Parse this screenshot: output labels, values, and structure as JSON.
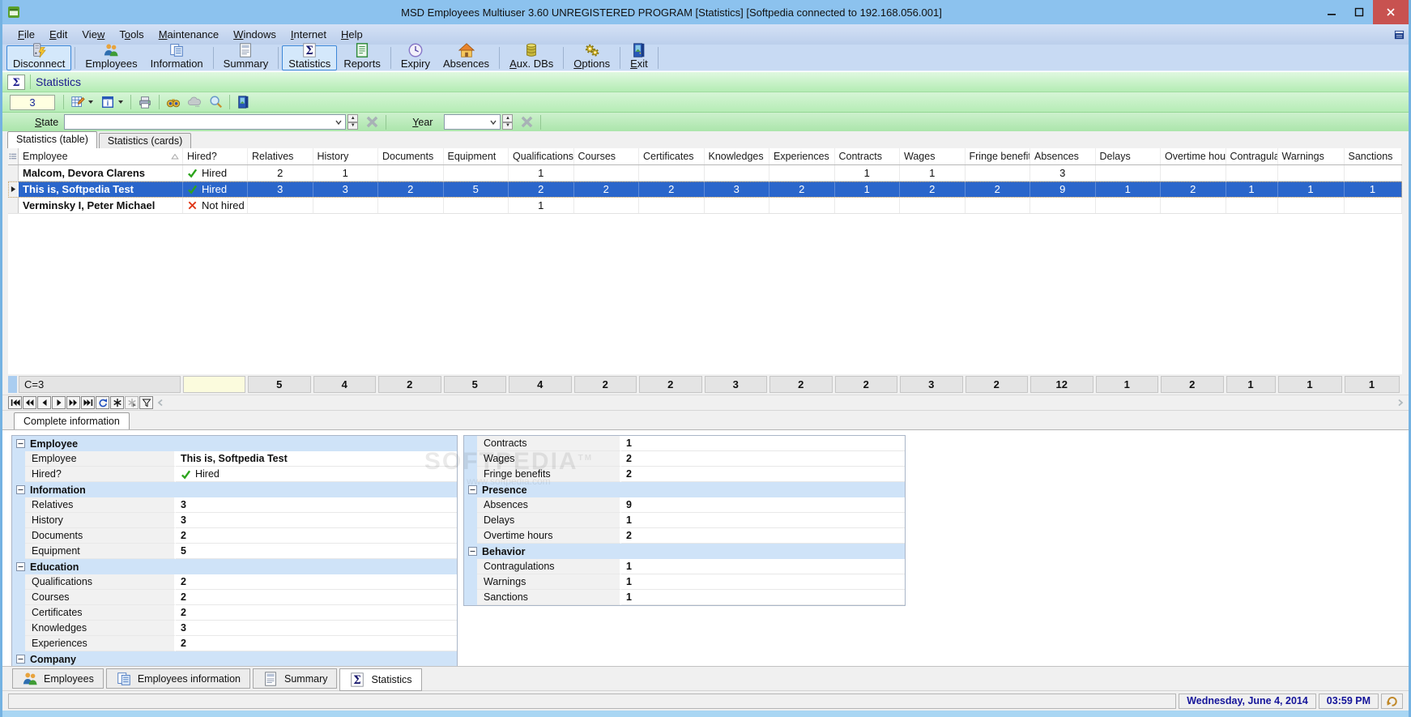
{
  "window": {
    "title": "MSD Employees Multiuser 3.60 UNREGISTERED PROGRAM [Statistics] [Softpedia connected to 192.168.056.001]"
  },
  "menu": {
    "items": [
      {
        "label": "File",
        "accel": 0
      },
      {
        "label": "Edit",
        "accel": 0
      },
      {
        "label": "View",
        "accel": 3
      },
      {
        "label": "Tools",
        "accel": 1
      },
      {
        "label": "Maintenance",
        "accel": 0
      },
      {
        "label": "Windows",
        "accel": 0
      },
      {
        "label": "Internet",
        "accel": 0
      },
      {
        "label": "Help",
        "accel": 0
      }
    ]
  },
  "toolbar": {
    "buttons": [
      {
        "label": "Disconnect",
        "icon": "disconnect",
        "active": true,
        "sep_after": true
      },
      {
        "label": "Employees",
        "icon": "employees"
      },
      {
        "label": "Information",
        "icon": "information",
        "sep_after": true
      },
      {
        "label": "Summary",
        "icon": "summary",
        "sep_after": true
      },
      {
        "label": "Statistics",
        "icon": "statistics",
        "active": true
      },
      {
        "label": "Reports",
        "icon": "reports",
        "sep_after": true
      },
      {
        "label": "Expiry",
        "icon": "expiry"
      },
      {
        "label": "Absences",
        "icon": "absences",
        "sep_after": true
      },
      {
        "label": "Aux. DBs",
        "icon": "auxdbs",
        "accel": 0,
        "sep_after": true
      },
      {
        "label": "Options",
        "icon": "options",
        "accel": 0,
        "sep_after": true
      },
      {
        "label": "Exit",
        "icon": "exit",
        "accel": 0,
        "sep_after": true
      }
    ]
  },
  "section": {
    "title": "Statistics"
  },
  "mini_toolbar": {
    "counter": "3",
    "buttons": [
      {
        "icon": "edit-grid",
        "caret": true
      },
      {
        "icon": "info-card",
        "caret": true
      },
      {
        "sep": true
      },
      {
        "icon": "print"
      },
      {
        "sep": true
      },
      {
        "icon": "binoculars"
      },
      {
        "icon": "cloud",
        "disabled": true
      },
      {
        "icon": "magnifier"
      },
      {
        "sep": true
      },
      {
        "icon": "exit-door"
      }
    ]
  },
  "filter_bar": {
    "state": {
      "label": "State",
      "accel": 0
    },
    "year": {
      "label": "Year",
      "accel": 0
    }
  },
  "view_tabs": [
    {
      "label": "Statistics (table)",
      "active": true
    },
    {
      "label": "Statistics (cards)",
      "active": false
    }
  ],
  "grid": {
    "columns": [
      "Employee",
      "Hired?",
      "Relatives",
      "History",
      "Documents",
      "Equipment",
      "Qualifications",
      "Courses",
      "Certificates",
      "Knowledges",
      "Experiences",
      "Contracts",
      "Wages",
      "Fringe benefits",
      "Absences",
      "Delays",
      "Overtime hours",
      "Contragulati",
      "Warnings",
      "Sanctions"
    ],
    "rows": [
      {
        "employee": "Malcom, Devora Clarens",
        "hired": true,
        "hired_label": "Hired",
        "selected": false,
        "values": [
          "2",
          "1",
          "",
          "",
          "1",
          "",
          "",
          "",
          "",
          "1",
          "1",
          "",
          "3",
          "",
          "",
          "",
          "",
          ""
        ]
      },
      {
        "employee": "This is, Softpedia Test",
        "hired": true,
        "hired_label": "Hired",
        "selected": true,
        "values": [
          "3",
          "3",
          "2",
          "5",
          "2",
          "2",
          "2",
          "3",
          "2",
          "1",
          "2",
          "2",
          "9",
          "1",
          "2",
          "1",
          "1",
          "1"
        ]
      },
      {
        "employee": "Verminsky I, Peter Michael",
        "hired": false,
        "hired_label": "Not hired",
        "selected": false,
        "values": [
          "",
          "",
          "",
          "",
          "1",
          "",
          "",
          "",
          "",
          "",
          "",
          "",
          "",
          "",
          "",
          "",
          "",
          ""
        ]
      }
    ],
    "summary": {
      "label": "C=3",
      "values": [
        "5",
        "4",
        "2",
        "5",
        "4",
        "2",
        "2",
        "3",
        "2",
        "2",
        "3",
        "2",
        "12",
        "1",
        "2",
        "1",
        "1",
        "1"
      ]
    }
  },
  "navigator": {
    "buttons": [
      {
        "name": "first"
      },
      {
        "name": "prior-page"
      },
      {
        "name": "prior"
      },
      {
        "name": "next"
      },
      {
        "name": "next-page"
      },
      {
        "name": "last"
      },
      {
        "name": "refresh"
      },
      {
        "name": "insert"
      },
      {
        "name": "cancel",
        "disabled": true
      },
      {
        "name": "filter"
      }
    ]
  },
  "detail": {
    "tab": "Complete information",
    "left_sections": [
      {
        "title": "Employee",
        "rows": [
          {
            "label": "Employee",
            "value": "This is, Softpedia Test"
          },
          {
            "label": "Hired?",
            "value": "Hired",
            "check": true
          }
        ]
      },
      {
        "title": "Information",
        "rows": [
          {
            "label": "Relatives",
            "value": "3"
          },
          {
            "label": "History",
            "value": "3"
          },
          {
            "label": "Documents",
            "value": "2"
          },
          {
            "label": "Equipment",
            "value": "5"
          }
        ]
      },
      {
        "title": "Education",
        "rows": [
          {
            "label": "Qualifications",
            "value": "2"
          },
          {
            "label": "Courses",
            "value": "2"
          },
          {
            "label": "Certificates",
            "value": "2"
          },
          {
            "label": "Knowledges",
            "value": "3"
          },
          {
            "label": "Experiences",
            "value": "2"
          }
        ]
      },
      {
        "title": "Company",
        "rows": []
      }
    ],
    "right_sections": [
      {
        "title": "",
        "rows": [
          {
            "label": "Contracts",
            "value": "1"
          },
          {
            "label": "Wages",
            "value": "2"
          },
          {
            "label": "Fringe benefits",
            "value": "2"
          }
        ]
      },
      {
        "title": "Presence",
        "rows": [
          {
            "label": "Absences",
            "value": "9"
          },
          {
            "label": "Delays",
            "value": "1"
          },
          {
            "label": "Overtime hours",
            "value": "2"
          }
        ]
      },
      {
        "title": "Behavior",
        "rows": [
          {
            "label": "Contragulations",
            "value": "1"
          },
          {
            "label": "Warnings",
            "value": "1"
          },
          {
            "label": "Sanctions",
            "value": "1"
          }
        ]
      }
    ]
  },
  "bottom_tabs": [
    {
      "label": "Employees",
      "icon": "employees",
      "active": false
    },
    {
      "label": "Employees information",
      "icon": "information",
      "active": false
    },
    {
      "label": "Summary",
      "icon": "summary",
      "active": false
    },
    {
      "label": "Statistics",
      "icon": "statistics",
      "active": true
    }
  ],
  "status": {
    "date": "Wednesday, June 4, 2014",
    "time": "03:59 PM"
  },
  "watermark": {
    "line1": "SOFTPEDIA",
    "tm": "TM",
    "line2": "www.softpedia.com"
  }
}
